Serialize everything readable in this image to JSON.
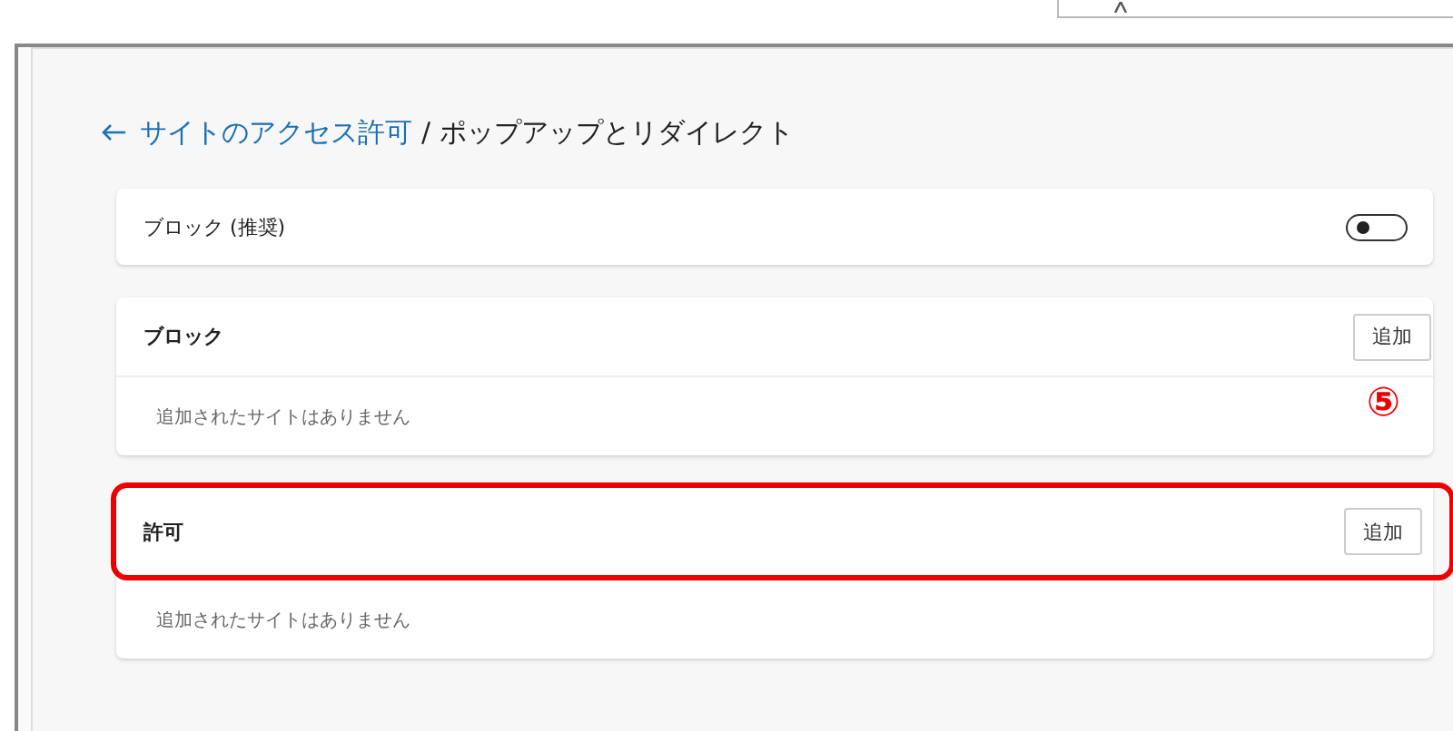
{
  "breadcrumb": {
    "parent": "サイトのアクセス許可",
    "separator": "/",
    "current": "ポップアップとリダイレクト"
  },
  "toggle_row": {
    "label": "ブロック (推奨)",
    "on": false
  },
  "sections": [
    {
      "title": "ブロック",
      "button": "追加",
      "empty_text": "追加されたサイトはありません",
      "highlighted": false,
      "annotation": "⑤"
    },
    {
      "title": "許可",
      "button": "追加",
      "empty_text": "追加されたサイトはありません",
      "highlighted": true
    }
  ]
}
